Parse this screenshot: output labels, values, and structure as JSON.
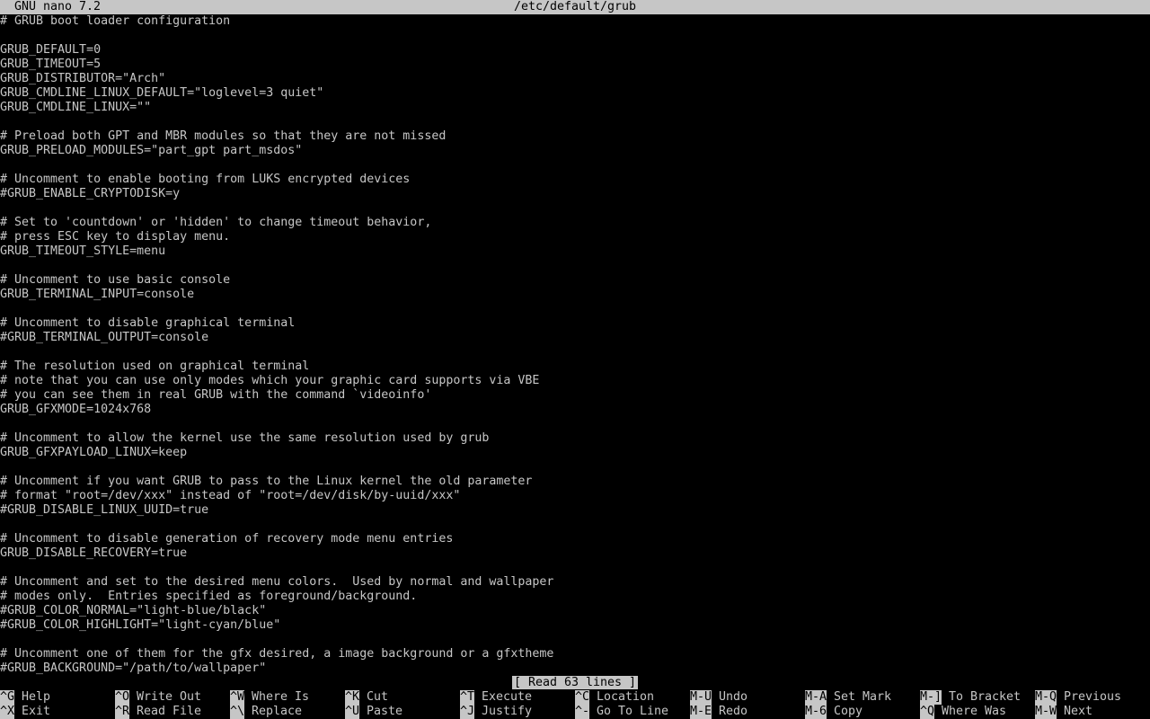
{
  "titlebar": {
    "app": "GNU nano 7.2",
    "file": "/etc/default/grub"
  },
  "lines": [
    "# GRUB boot loader configuration",
    "",
    "GRUB_DEFAULT=0",
    "GRUB_TIMEOUT=5",
    "GRUB_DISTRIBUTOR=\"Arch\"",
    "GRUB_CMDLINE_LINUX_DEFAULT=\"loglevel=3 quiet\"",
    "GRUB_CMDLINE_LINUX=\"\"",
    "",
    "# Preload both GPT and MBR modules so that they are not missed",
    "GRUB_PRELOAD_MODULES=\"part_gpt part_msdos\"",
    "",
    "# Uncomment to enable booting from LUKS encrypted devices",
    "#GRUB_ENABLE_CRYPTODISK=y",
    "",
    "# Set to 'countdown' or 'hidden' to change timeout behavior,",
    "# press ESC key to display menu.",
    "GRUB_TIMEOUT_STYLE=menu",
    "",
    "# Uncomment to use basic console",
    "GRUB_TERMINAL_INPUT=console",
    "",
    "# Uncomment to disable graphical terminal",
    "#GRUB_TERMINAL_OUTPUT=console",
    "",
    "# The resolution used on graphical terminal",
    "# note that you can use only modes which your graphic card supports via VBE",
    "# you can see them in real GRUB with the command `videoinfo'",
    "GRUB_GFXMODE=1024x768",
    "",
    "# Uncomment to allow the kernel use the same resolution used by grub",
    "GRUB_GFXPAYLOAD_LINUX=keep",
    "",
    "# Uncomment if you want GRUB to pass to the Linux kernel the old parameter",
    "# format \"root=/dev/xxx\" instead of \"root=/dev/disk/by-uuid/xxx\"",
    "#GRUB_DISABLE_LINUX_UUID=true",
    "",
    "# Uncomment to disable generation of recovery mode menu entries",
    "GRUB_DISABLE_RECOVERY=true",
    "",
    "# Uncomment and set to the desired menu colors.  Used by normal and wallpaper",
    "# modes only.  Entries specified as foreground/background.",
    "#GRUB_COLOR_NORMAL=\"light-blue/black\"",
    "#GRUB_COLOR_HIGHLIGHT=\"light-cyan/blue\"",
    "",
    "# Uncomment one of them for the gfx desired, a image background or a gfxtheme",
    "#GRUB_BACKGROUND=\"/path/to/wallpaper\""
  ],
  "status": "[ Read 63 lines ]",
  "shortcuts": [
    {
      "key": "^G",
      "label": "Help"
    },
    {
      "key": "^X",
      "label": "Exit"
    },
    {
      "key": "^O",
      "label": "Write Out"
    },
    {
      "key": "^R",
      "label": "Read File"
    },
    {
      "key": "^W",
      "label": "Where Is"
    },
    {
      "key": "^\\",
      "label": "Replace"
    },
    {
      "key": "^K",
      "label": "Cut"
    },
    {
      "key": "^U",
      "label": "Paste"
    },
    {
      "key": "^T",
      "label": "Execute"
    },
    {
      "key": "^J",
      "label": "Justify"
    },
    {
      "key": "^C",
      "label": "Location"
    },
    {
      "key": "^-",
      "label": "Go To Line"
    },
    {
      "key": "M-U",
      "label": "Undo"
    },
    {
      "key": "M-E",
      "label": "Redo"
    },
    {
      "key": "M-A",
      "label": "Set Mark"
    },
    {
      "key": "M-6",
      "label": "Copy"
    },
    {
      "key": "M-]",
      "label": "To Bracket"
    },
    {
      "key": "^Q",
      "label": "Where Was"
    },
    {
      "key": "M-Q",
      "label": "Previous"
    },
    {
      "key": "M-W",
      "label": "Next"
    }
  ]
}
